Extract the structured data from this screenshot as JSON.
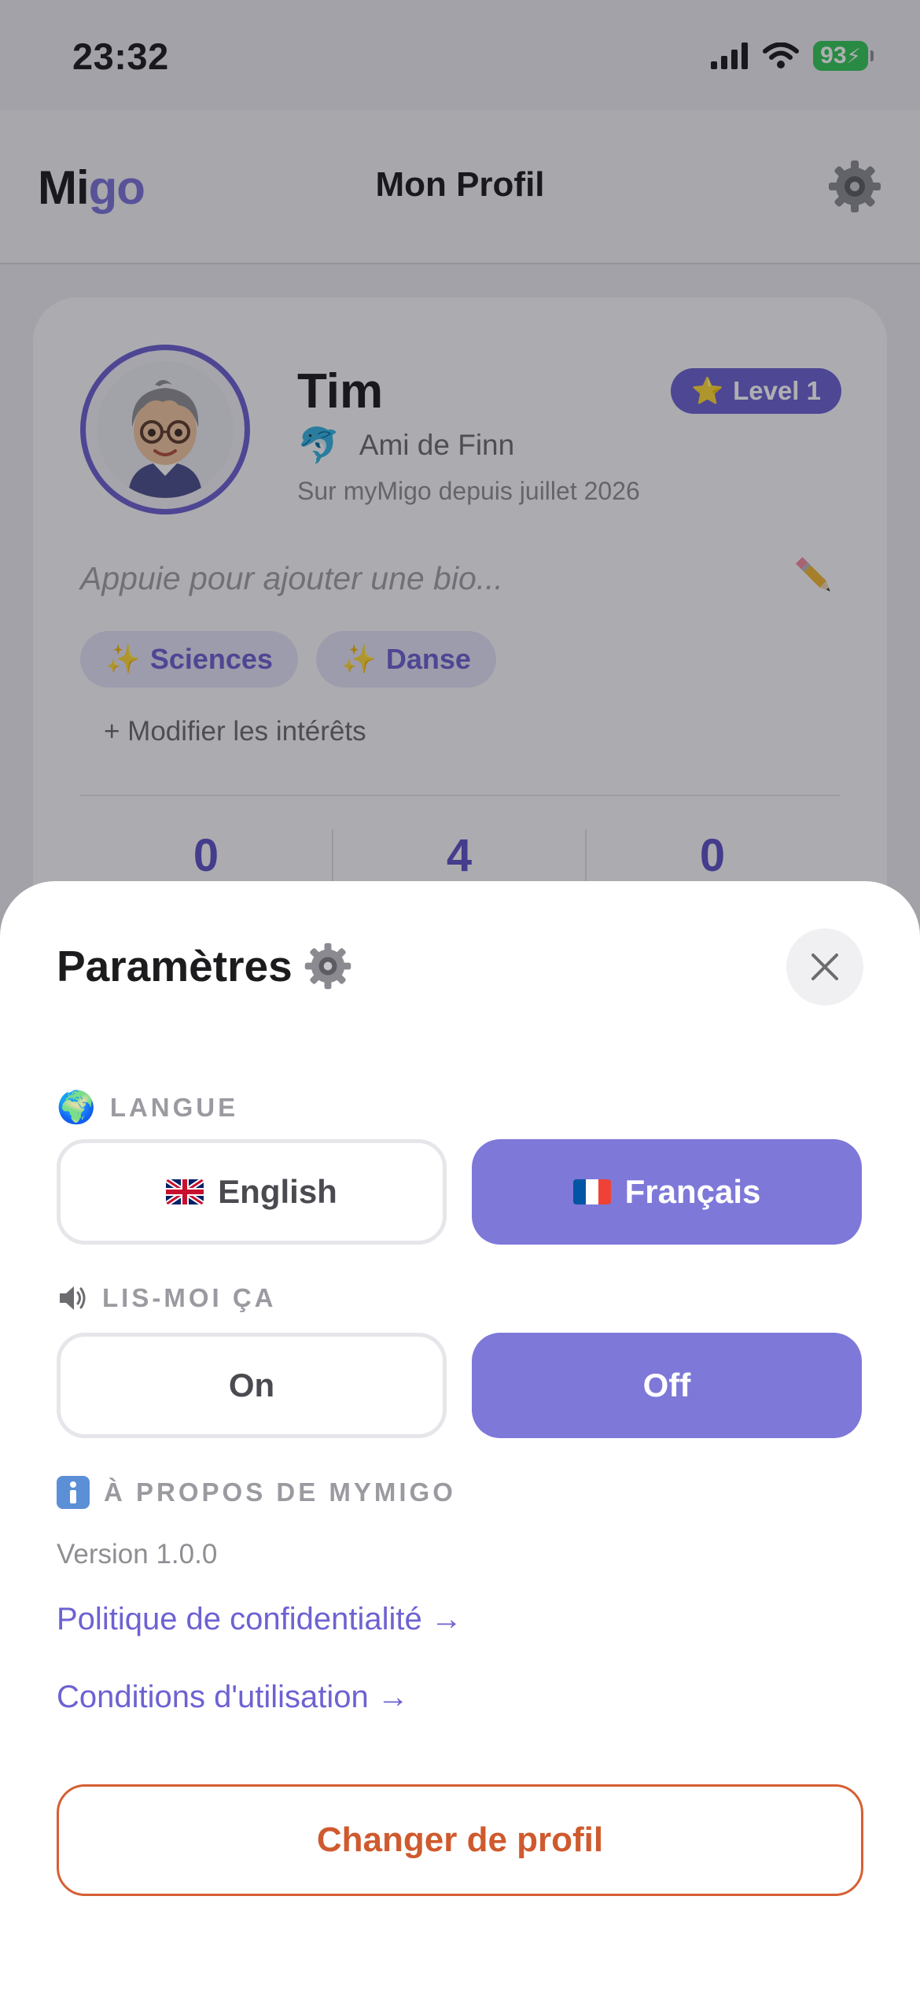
{
  "status_bar": {
    "time": "23:32",
    "battery": "93"
  },
  "nav": {
    "logo_part1": "Mi",
    "logo_part2": "go",
    "title": "Mon Profil"
  },
  "profile": {
    "name": "Tim",
    "level": "Level 1",
    "friend": "Ami de Finn",
    "member_since": "Sur myMigo depuis juillet 2026",
    "bio_placeholder": "Appuie pour ajouter une bio...",
    "interests": [
      "Sciences",
      "Danse"
    ],
    "edit_interests": "+ Modifier les intérêts",
    "stats": [
      "0",
      "4",
      "0"
    ]
  },
  "settings": {
    "title": "Paramètres",
    "language_label": "LANGUE",
    "language_options": [
      "English",
      "Français"
    ],
    "language_selected": "Français",
    "read_aloud_label": "LIS-MOI ÇA",
    "read_aloud_options": [
      "On",
      "Off"
    ],
    "read_aloud_selected": "Off",
    "about_label": "À PROPOS DE MYMIGO",
    "version": "Version 1.0.0",
    "privacy_link": "Politique de confidentialité →",
    "terms_link": "Conditions d'utilisation →",
    "switch_profile": "Changer de profil"
  },
  "colors": {
    "accent": "#7e78d9",
    "accent_dark": "#6d62d2",
    "danger": "#d65f33"
  },
  "icons": [
    "gear-icon",
    "dolphin-icon",
    "pencil-icon",
    "sparkles-icon",
    "globe-icon",
    "speaker-icon",
    "info-icon",
    "close-icon",
    "star-icon"
  ]
}
